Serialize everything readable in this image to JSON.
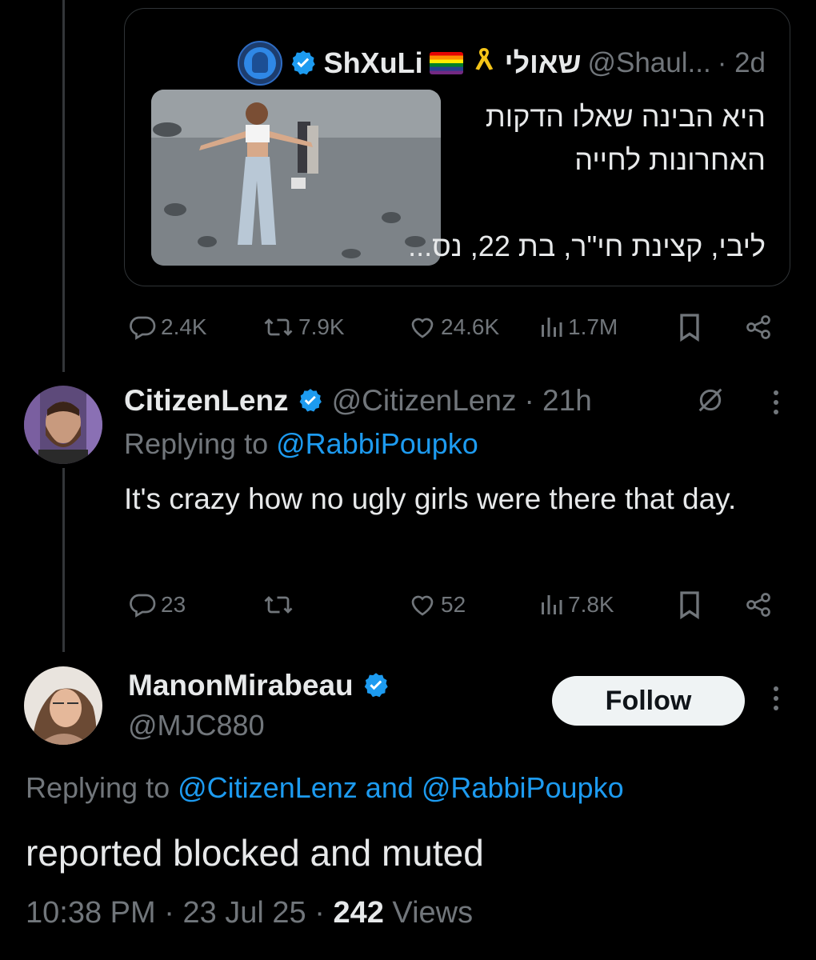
{
  "quoted_tweet": {
    "display_name": "ShXuLi",
    "hebrew_name": "שאולי",
    "handle": "@Shaul...",
    "time": "· 2d",
    "text_lines": [
      "היא הבינה שאלו הדקות",
      "האחרונות לחייה",
      "",
      "ליבי, קצינת חי\"ר, בת 22, נס..."
    ],
    "stats": {
      "replies": "2.4K",
      "reposts": "7.9K",
      "likes": "24.6K",
      "views": "1.7M"
    }
  },
  "reply_tweet": {
    "display_name": "CitizenLenz",
    "handle": "@CitizenLenz",
    "time": "· 21h",
    "replying_prefix": "Replying to",
    "replying_to": "@RabbiPoupko",
    "text": "It's crazy how no ugly girls were there that day.",
    "stats": {
      "replies": "23",
      "reposts": "",
      "likes": "52",
      "views": "7.8K"
    }
  },
  "main_tweet": {
    "display_name": "ManonMirabeau",
    "handle": "@MJC880",
    "follow_label": "Follow",
    "replying_prefix": "Replying to",
    "replying_to_1": "@CitizenLenz",
    "replying_and": "and",
    "replying_to_2": "@RabbiPoupko",
    "text": "reported blocked and muted",
    "time": "10:38 PM",
    "date": "23 Jul 25",
    "views_count": "242",
    "views_label": "Views"
  },
  "colors": {
    "background": "#000000",
    "accent": "#1d9bf0",
    "muted": "#71767b",
    "text": "#e7e9ea"
  }
}
